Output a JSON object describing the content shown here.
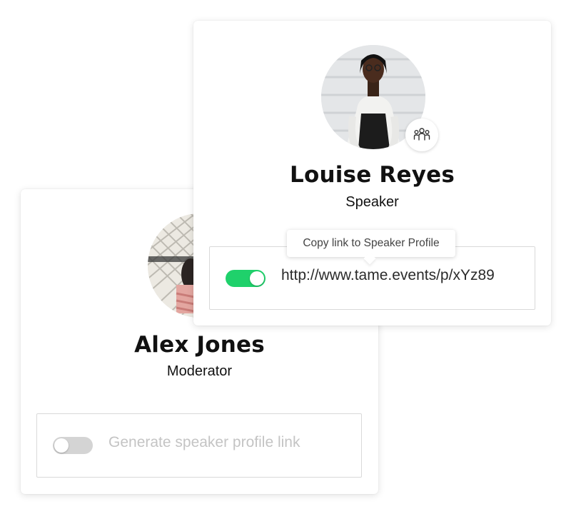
{
  "cards": {
    "back": {
      "name": "Alex Jones",
      "role": "Moderator",
      "toggle_on": false,
      "link_label": "Generate speaker profile link"
    },
    "front": {
      "name": "Louise Reyes",
      "role": "Speaker",
      "badge_icon": "people-group-icon",
      "toggle_on": true,
      "link_url": "http://www.tame.events/p/xYz89",
      "tooltip": "Copy link to Speaker Profile"
    }
  },
  "colors": {
    "toggle_on": "#1fd16b",
    "toggle_off": "#d4d4d4"
  }
}
